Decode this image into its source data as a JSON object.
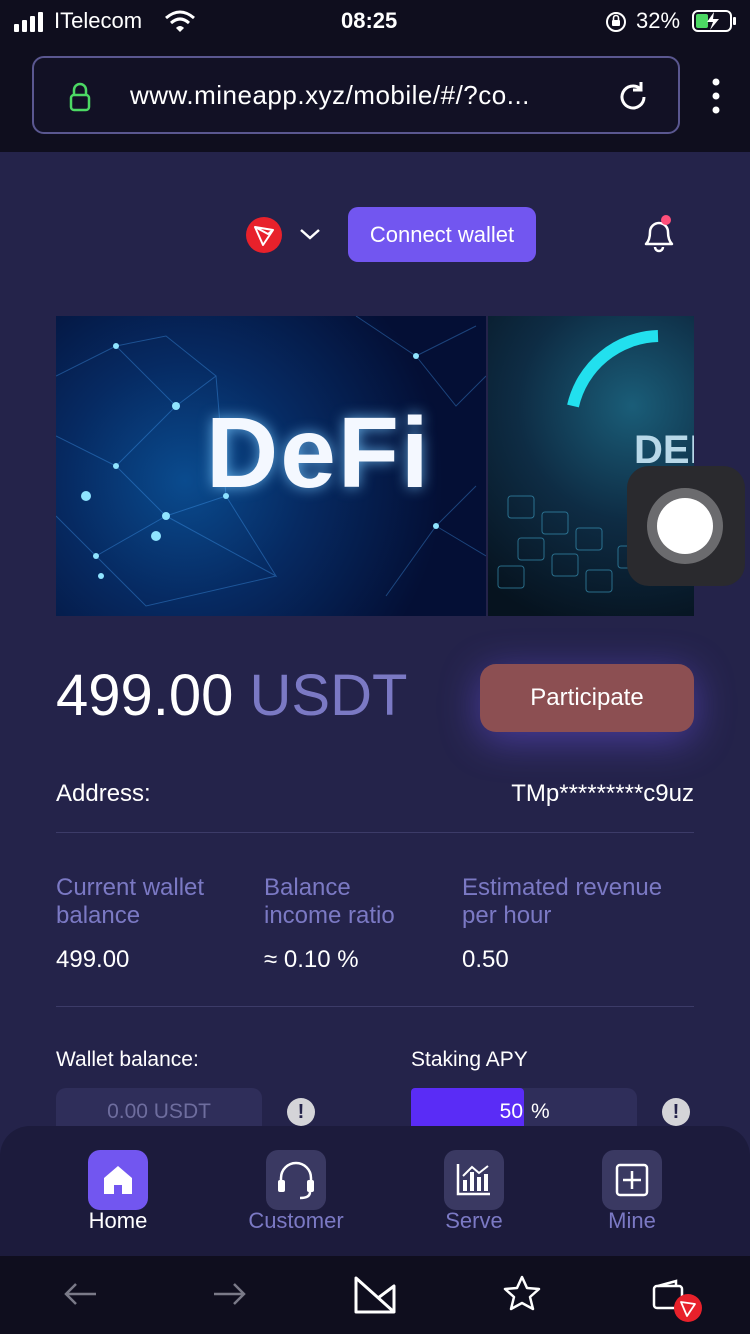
{
  "status_bar": {
    "carrier": "ITelecom",
    "time": "08:25",
    "battery": "32%"
  },
  "browser": {
    "url": "www.mineapp.xyz/mobile/#/?co..."
  },
  "header": {
    "network_icon": "tron-icon",
    "connect_label": "Connect wallet"
  },
  "banner": {
    "title": "DeFi",
    "second_title": "DEF"
  },
  "summary": {
    "amount": "499.00",
    "unit": "USDT",
    "participate_label": "Participate"
  },
  "address": {
    "label": "Address:",
    "value": "TMp*********c9uz"
  },
  "stats": [
    {
      "title_line1": "Current wallet",
      "title_line2": "balance",
      "value": "499.00"
    },
    {
      "title_line1": "Balance",
      "title_line2": "income ratio",
      "value": "≈ 0.10 %"
    },
    {
      "title_line1": "Estimated revenue",
      "title_line2": "per hour",
      "value": "0.50"
    }
  ],
  "wallet": {
    "label": "Wallet balance:",
    "value": "0.00 USDT"
  },
  "staking": {
    "label": "Staking APY",
    "value": "50",
    "unit": "%",
    "fill_percent": 50
  },
  "tabs": [
    {
      "label": "Home",
      "icon": "home-icon",
      "active": true
    },
    {
      "label": "Customer",
      "icon": "headset-icon",
      "active": false
    },
    {
      "label": "Serve",
      "icon": "chart-icon",
      "active": false
    },
    {
      "label": "Mine",
      "icon": "plus-square-icon",
      "active": false
    }
  ],
  "colors": {
    "background": "#24234a",
    "accent": "#7256f0",
    "participate": "#8c4f52",
    "muted_text": "#7b79c4",
    "notification_dot": "#ff4f7a",
    "tron_red": "#e8212b"
  }
}
